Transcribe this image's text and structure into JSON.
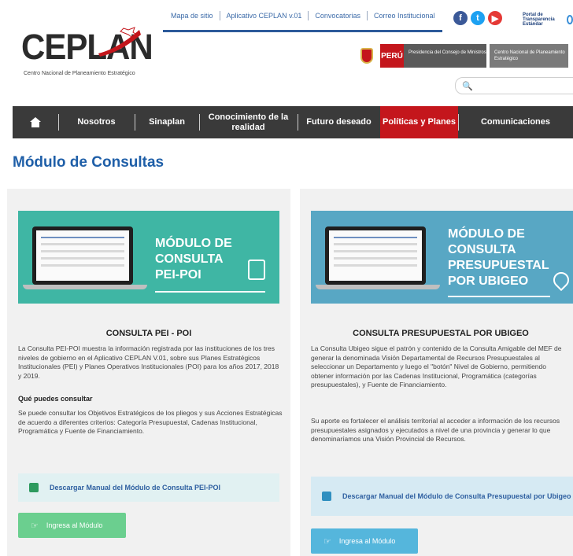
{
  "header": {
    "top_links": [
      "Mapa de sitio",
      "Aplicativo CEPLAN v.01",
      "Convocatorias",
      "Correo Institucional"
    ],
    "social": [
      {
        "icon": "facebook-icon",
        "glyph": "f",
        "color": "#3b5998"
      },
      {
        "icon": "twitter-icon",
        "glyph": "t",
        "color": "#1da1f2"
      },
      {
        "icon": "youtube-icon",
        "glyph": "▶",
        "color": "#e53935"
      }
    ],
    "transparencia": "Portal de Transparencia Estándar",
    "logo_text": "CEPLAN",
    "logo_sub": "Centro Nacional de Planeamiento Estratégico",
    "gov": {
      "peru": "PERÚ",
      "pcm": "Presidencia del Consejo de Ministros",
      "ceplan": "Centro Nacional de Planeamiento Estratégico"
    },
    "search_placeholder": ""
  },
  "nav": {
    "items": [
      {
        "label": "Nosotros"
      },
      {
        "label": "Sinaplan"
      },
      {
        "label": "Conocimiento de la realidad"
      },
      {
        "label": "Futuro deseado"
      },
      {
        "label": "Políticas y Planes",
        "active": true
      },
      {
        "label": "Comunicaciones"
      }
    ]
  },
  "page": {
    "title": "Módulo de Consultas"
  },
  "cards": {
    "left": {
      "banner_title": [
        "MÓDULO DE",
        "CONSULTA",
        "PEI-POI"
      ],
      "title": "CONSULTA PEI - POI",
      "p1": "La Consulta PEI-POI muestra la información registrada por las instituciones de los tres niveles de gobierno en el Aplicativo CEPLAN V.01, sobre sus Planes Estratégicos Institucionales (PEI) y Planes Operativos Institucionales (POI) para los años 2017, 2018 y 2019.",
      "subtitle": "Qué puedes consultar",
      "p2": "Se puede consultar los Objetivos Estratégicos de los pliegos y sus Acciones Estratégicas de acuerdo a diferentes criterios: Categoría Presupuestal, Cadenas Institucional, Programática y Fuente de Financiamiento.",
      "download": "Descargar Manual del Módulo de Consulta PEI-POI",
      "button": "Ingresa al Módulo",
      "accent": "#3fb6a4"
    },
    "right": {
      "banner_title": [
        "MÓDULO DE",
        "CONSULTA",
        "PRESUPUESTAL",
        "POR UBIGEO"
      ],
      "title": "CONSULTA PRESUPUESTAL POR UBIGEO",
      "p1": "La Consulta Ubigeo sigue el patrón y contenido de la Consulta Amigable del MEF de generar la denominada Visión Departamental de Recursos Presupuestales al seleccionar un Departamento y luego el \"botón\" Nivel de Gobierno, permitiendo obtener información por las Cadenas Institucional, Programática (categorías presupuestales), y Fuente de Financiamiento.",
      "p2": "Su aporte es fortalecer el análisis territorial al acceder a información de los recursos presupuestales asignados y ejecutados a nivel de una provincia y generar lo que denominaríamos una Visión Provincial de Recursos.",
      "download": "Descargar Manual del Módulo de Consulta Presupuestal por Ubigeo",
      "button": "Ingresa al Módulo",
      "accent": "#58a7c4"
    }
  }
}
